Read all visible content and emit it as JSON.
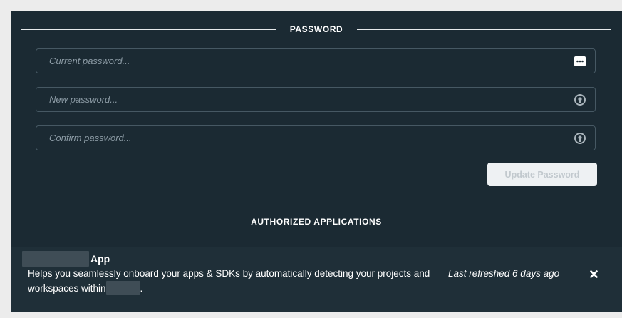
{
  "password_section": {
    "title": "PASSWORD",
    "current_placeholder": "Current password...",
    "new_placeholder": "New password...",
    "confirm_placeholder": "Confirm password...",
    "update_button": "Update Password",
    "icons": [
      "password-dots-icon",
      "eye-icon",
      "eye-icon"
    ]
  },
  "authorized_section": {
    "title": "AUTHORIZED APPLICATIONS",
    "apps": [
      {
        "name_suffix": "App",
        "description_main": "Helps you seamlessly onboard your apps & SDKs by automatically detecting your projects and workspaces within",
        "description_end": ".",
        "last_refreshed": "Last refreshed 6 days ago",
        "remove_icon": "close-icon"
      }
    ]
  },
  "colors": {
    "panel": "#1b2a33",
    "field_border": "#465863",
    "button_bg": "#eef1f3",
    "button_text": "#c2c9ce"
  }
}
